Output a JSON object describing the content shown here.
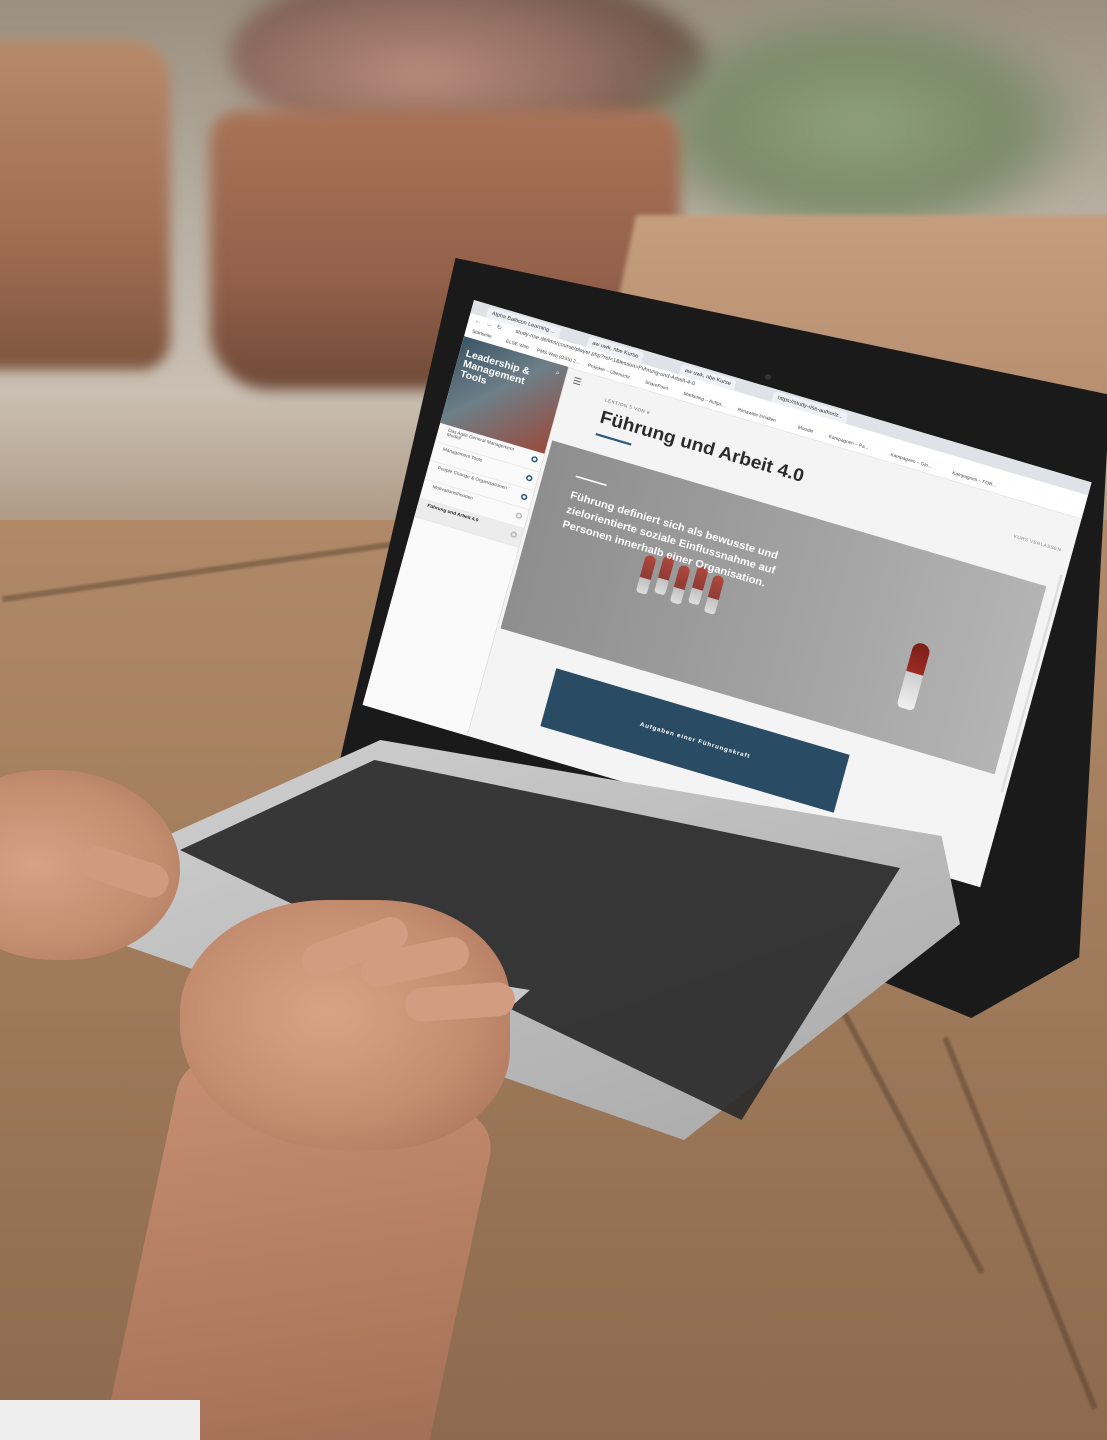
{
  "browser": {
    "tabs": [
      {
        "label": "Alpha Balticon Learning ..."
      },
      {
        "label": "aw uwk, nbe Kurse"
      },
      {
        "label": "aw uwk, nbe Kurse"
      },
      {
        "label": "https://study-rise-authoriz..."
      }
    ],
    "url": "study-rise.de/lms/course/player.php?ref=1&lesson=Fuhrung-und-Arbeit-4-0",
    "bookmarks": [
      "Startseite",
      "ELSE Web",
      "PMS Web (OSS) 2...",
      "Projekte – Übersicht",
      "SharePoint",
      "Marketing – Aufga...",
      "Rimawitte Inhalten",
      "Moodle",
      "Kampagnen – Pa...",
      "Kampagnen – Glo...",
      "Kampagnen – FOR..."
    ]
  },
  "sidebar": {
    "course_title": "Leadership & Management Tools",
    "items": [
      {
        "label": "Das Agile General Management Modell",
        "status": "complete"
      },
      {
        "label": "Management Tools",
        "status": "complete"
      },
      {
        "label": "People Change & Organisationen",
        "status": "complete"
      },
      {
        "label": "Motivationstheorien",
        "status": "incomplete"
      },
      {
        "label": "Führung und Arbeit 4.0",
        "status": "incomplete",
        "active": true
      }
    ]
  },
  "lesson": {
    "counter": "LEKTION 5 VON 8",
    "title": "Führung und Arbeit 4.0",
    "exit_label": "KURS VERLASSEN",
    "banner_quote": "Führung definiert sich als bewusste und zielorientierte soziale Einflussnahme auf Personen innerhalb einer Organisation.",
    "cta_label": "Aufgaben einer Führungskraft"
  },
  "colors": {
    "accent": "#2c5a7c",
    "cta_bg": "#2a4b64",
    "banner_bg": "#9a9a9a"
  }
}
